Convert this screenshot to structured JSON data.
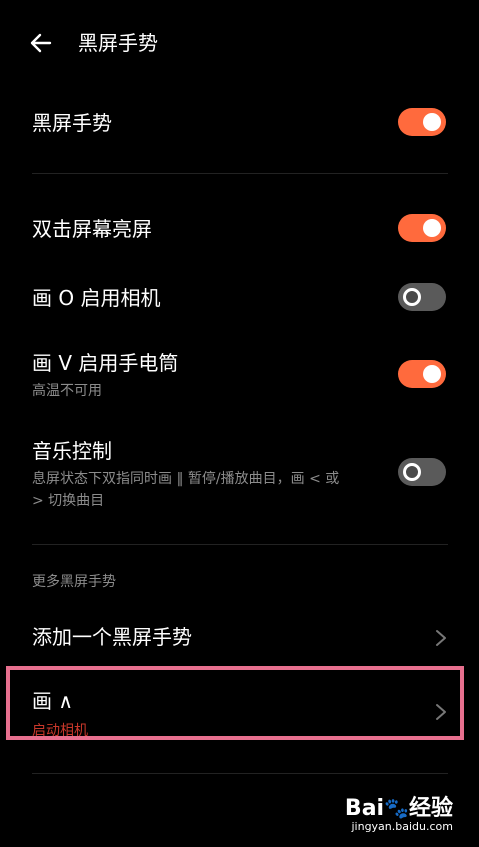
{
  "header": {
    "title": "黑屏手势"
  },
  "settings": {
    "master": {
      "label": "黑屏手势",
      "state": "on"
    },
    "items": [
      {
        "label": "双击屏幕亮屏",
        "sub": "",
        "state": "on"
      },
      {
        "label": "画 O 启用相机",
        "sub": "",
        "state": "off"
      },
      {
        "label": "画 V 启用手电筒",
        "sub": "高温不可用",
        "state": "on"
      },
      {
        "label": "音乐控制",
        "sub_line1": "息屏状态下双指同时画 ‖ 暂停/播放曲目，画 < 或",
        "sub_line2": "> 切换曲目",
        "state": "off"
      }
    ]
  },
  "more": {
    "section_title": "更多黑屏手势",
    "add_label": "添加一个黑屏手势",
    "custom": {
      "label": "画 ∧",
      "sub": "启动相机"
    }
  },
  "colors": {
    "accent": "#ff6a3d",
    "highlight": "#e8708f",
    "toggle_off": "#5a5a5a"
  },
  "watermark": {
    "brand_part1": "Bai",
    "brand_part2": "经验",
    "url": "jingyan.baidu.com"
  }
}
